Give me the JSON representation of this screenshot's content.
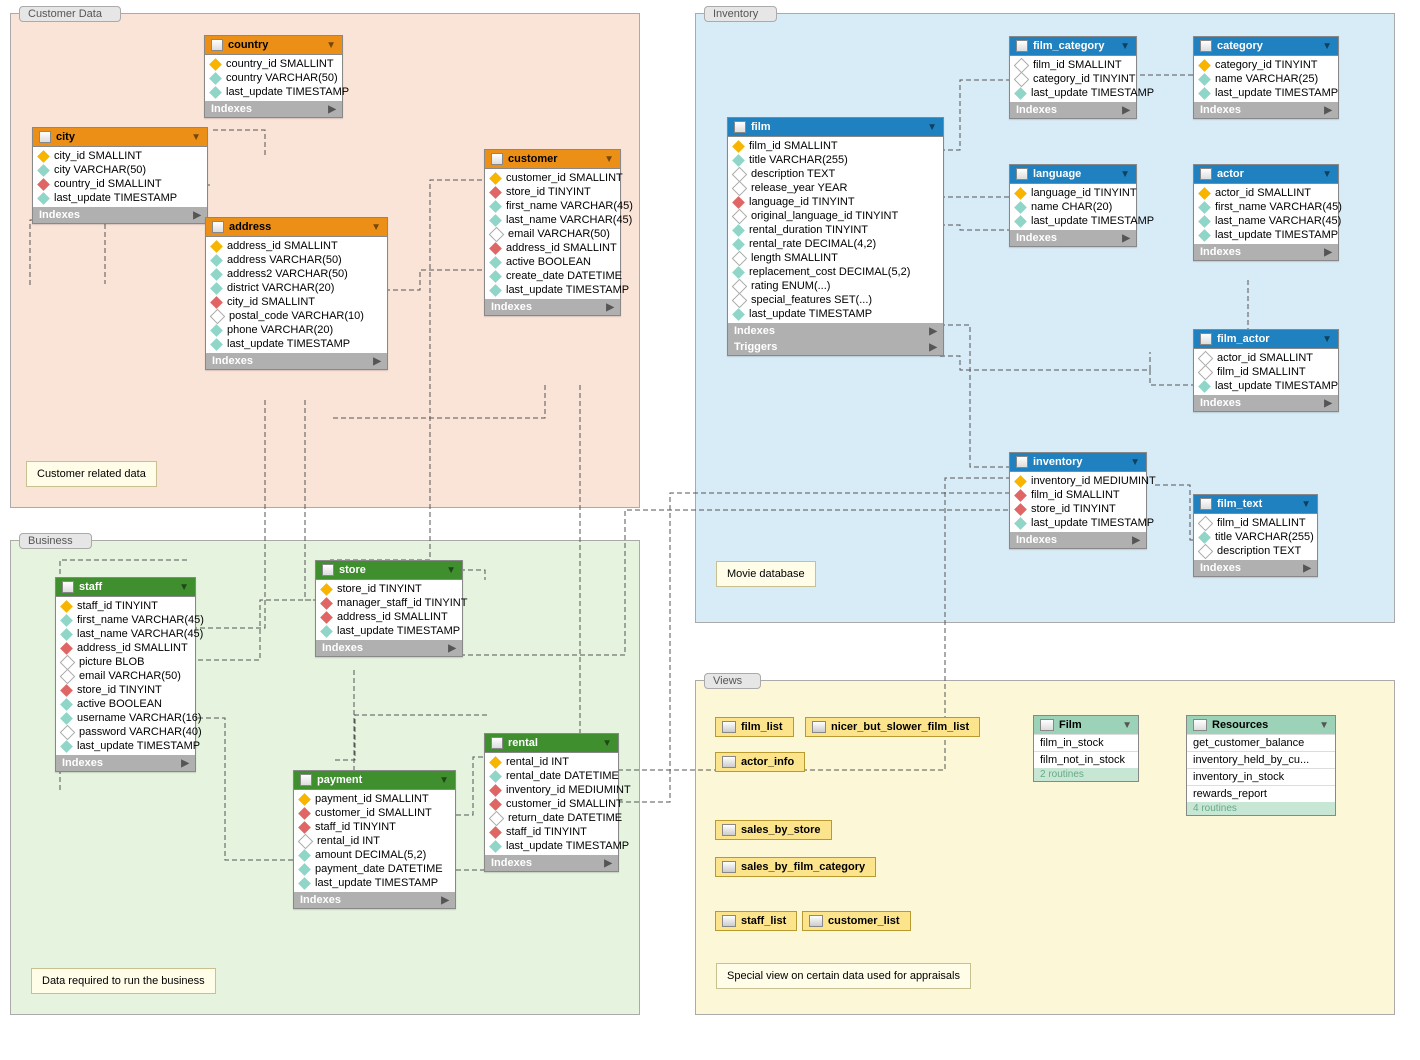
{
  "layers": {
    "customer": {
      "title": "Customer Data",
      "note": "Customer related data"
    },
    "business": {
      "title": "Business",
      "note": "Data required to run the business"
    },
    "inventory": {
      "title": "Inventory",
      "note": "Movie database"
    },
    "views": {
      "title": "Views",
      "note": "Special view on certain data used for appraisals"
    }
  },
  "entities": {
    "country": {
      "title": "country",
      "cols": [
        {
          "t": "pk",
          "name": "country_id SMALLINT"
        },
        {
          "t": "a",
          "name": "country VARCHAR(50)"
        },
        {
          "t": "a",
          "name": "last_update TIMESTAMP"
        }
      ],
      "sections": [
        "Indexes"
      ]
    },
    "city": {
      "title": "city",
      "cols": [
        {
          "t": "pk",
          "name": "city_id SMALLINT"
        },
        {
          "t": "a",
          "name": "city VARCHAR(50)"
        },
        {
          "t": "fk",
          "name": "country_id SMALLINT"
        },
        {
          "t": "a",
          "name": "last_update TIMESTAMP"
        }
      ],
      "sections": [
        "Indexes"
      ]
    },
    "address": {
      "title": "address",
      "cols": [
        {
          "t": "pk",
          "name": "address_id SMALLINT"
        },
        {
          "t": "a",
          "name": "address VARCHAR(50)"
        },
        {
          "t": "a",
          "name": "address2 VARCHAR(50)"
        },
        {
          "t": "a",
          "name": "district VARCHAR(20)"
        },
        {
          "t": "fk",
          "name": "city_id SMALLINT"
        },
        {
          "t": "n",
          "name": "postal_code VARCHAR(10)"
        },
        {
          "t": "a",
          "name": "phone VARCHAR(20)"
        },
        {
          "t": "a",
          "name": "last_update TIMESTAMP"
        }
      ],
      "sections": [
        "Indexes"
      ]
    },
    "customer": {
      "title": "customer",
      "cols": [
        {
          "t": "pk",
          "name": "customer_id SMALLINT"
        },
        {
          "t": "fk",
          "name": "store_id TINYINT"
        },
        {
          "t": "a",
          "name": "first_name VARCHAR(45)"
        },
        {
          "t": "a",
          "name": "last_name VARCHAR(45)"
        },
        {
          "t": "n",
          "name": "email VARCHAR(50)"
        },
        {
          "t": "fk",
          "name": "address_id SMALLINT"
        },
        {
          "t": "a",
          "name": "active BOOLEAN"
        },
        {
          "t": "a",
          "name": "create_date DATETIME"
        },
        {
          "t": "a",
          "name": "last_update TIMESTAMP"
        }
      ],
      "sections": [
        "Indexes"
      ]
    },
    "staff": {
      "title": "staff",
      "cols": [
        {
          "t": "pk",
          "name": "staff_id TINYINT"
        },
        {
          "t": "a",
          "name": "first_name VARCHAR(45)"
        },
        {
          "t": "a",
          "name": "last_name VARCHAR(45)"
        },
        {
          "t": "fk",
          "name": "address_id SMALLINT"
        },
        {
          "t": "n",
          "name": "picture BLOB"
        },
        {
          "t": "n",
          "name": "email VARCHAR(50)"
        },
        {
          "t": "fk",
          "name": "store_id TINYINT"
        },
        {
          "t": "a",
          "name": "active BOOLEAN"
        },
        {
          "t": "a",
          "name": "username VARCHAR(16)"
        },
        {
          "t": "n",
          "name": "password VARCHAR(40)"
        },
        {
          "t": "a",
          "name": "last_update TIMESTAMP"
        }
      ],
      "sections": [
        "Indexes"
      ]
    },
    "store": {
      "title": "store",
      "cols": [
        {
          "t": "pk",
          "name": "store_id TINYINT"
        },
        {
          "t": "fk",
          "name": "manager_staff_id TINYINT"
        },
        {
          "t": "fk",
          "name": "address_id SMALLINT"
        },
        {
          "t": "a",
          "name": "last_update TIMESTAMP"
        }
      ],
      "sections": [
        "Indexes"
      ]
    },
    "payment": {
      "title": "payment",
      "cols": [
        {
          "t": "pk",
          "name": "payment_id SMALLINT"
        },
        {
          "t": "fk",
          "name": "customer_id SMALLINT"
        },
        {
          "t": "fk",
          "name": "staff_id TINYINT"
        },
        {
          "t": "n",
          "name": "rental_id INT"
        },
        {
          "t": "a",
          "name": "amount DECIMAL(5,2)"
        },
        {
          "t": "a",
          "name": "payment_date DATETIME"
        },
        {
          "t": "a",
          "name": "last_update TIMESTAMP"
        }
      ],
      "sections": [
        "Indexes"
      ]
    },
    "rental": {
      "title": "rental",
      "cols": [
        {
          "t": "pk",
          "name": "rental_id INT"
        },
        {
          "t": "a",
          "name": "rental_date DATETIME"
        },
        {
          "t": "fk",
          "name": "inventory_id MEDIUMINT"
        },
        {
          "t": "fk",
          "name": "customer_id SMALLINT"
        },
        {
          "t": "n",
          "name": "return_date DATETIME"
        },
        {
          "t": "fk",
          "name": "staff_id TINYINT"
        },
        {
          "t": "a",
          "name": "last_update TIMESTAMP"
        }
      ],
      "sections": [
        "Indexes"
      ]
    },
    "film": {
      "title": "film",
      "cols": [
        {
          "t": "pk",
          "name": "film_id SMALLINT"
        },
        {
          "t": "a",
          "name": "title VARCHAR(255)"
        },
        {
          "t": "n",
          "name": "description TEXT"
        },
        {
          "t": "n",
          "name": "release_year YEAR"
        },
        {
          "t": "fk",
          "name": "language_id TINYINT"
        },
        {
          "t": "n",
          "name": "original_language_id TINYINT"
        },
        {
          "t": "a",
          "name": "rental_duration TINYINT"
        },
        {
          "t": "a",
          "name": "rental_rate DECIMAL(4,2)"
        },
        {
          "t": "n",
          "name": "length SMALLINT"
        },
        {
          "t": "a",
          "name": "replacement_cost DECIMAL(5,2)"
        },
        {
          "t": "n",
          "name": "rating ENUM(...)"
        },
        {
          "t": "n",
          "name": "special_features SET(...)"
        },
        {
          "t": "a",
          "name": "last_update TIMESTAMP"
        }
      ],
      "sections": [
        "Indexes",
        "Triggers"
      ]
    },
    "film_category": {
      "title": "film_category",
      "cols": [
        {
          "t": "n",
          "name": "film_id SMALLINT"
        },
        {
          "t": "n",
          "name": "category_id TINYINT"
        },
        {
          "t": "a",
          "name": "last_update TIMESTAMP"
        }
      ],
      "sections": [
        "Indexes"
      ]
    },
    "category": {
      "title": "category",
      "cols": [
        {
          "t": "pk",
          "name": "category_id TINYINT"
        },
        {
          "t": "a",
          "name": "name VARCHAR(25)"
        },
        {
          "t": "a",
          "name": "last_update TIMESTAMP"
        }
      ],
      "sections": [
        "Indexes"
      ]
    },
    "language": {
      "title": "language",
      "cols": [
        {
          "t": "pk",
          "name": "language_id TINYINT"
        },
        {
          "t": "a",
          "name": "name CHAR(20)"
        },
        {
          "t": "a",
          "name": "last_update TIMESTAMP"
        }
      ],
      "sections": [
        "Indexes"
      ]
    },
    "actor": {
      "title": "actor",
      "cols": [
        {
          "t": "pk",
          "name": "actor_id SMALLINT"
        },
        {
          "t": "a",
          "name": "first_name VARCHAR(45)"
        },
        {
          "t": "a",
          "name": "last_name VARCHAR(45)"
        },
        {
          "t": "a",
          "name": "last_update TIMESTAMP"
        }
      ],
      "sections": [
        "Indexes"
      ]
    },
    "film_actor": {
      "title": "film_actor",
      "cols": [
        {
          "t": "n",
          "name": "actor_id SMALLINT"
        },
        {
          "t": "n",
          "name": "film_id SMALLINT"
        },
        {
          "t": "a",
          "name": "last_update TIMESTAMP"
        }
      ],
      "sections": [
        "Indexes"
      ]
    },
    "inventory_ent": {
      "title": "inventory",
      "cols": [
        {
          "t": "pk",
          "name": "inventory_id MEDIUMINT"
        },
        {
          "t": "fk",
          "name": "film_id SMALLINT"
        },
        {
          "t": "fk",
          "name": "store_id TINYINT"
        },
        {
          "t": "a",
          "name": "last_update TIMESTAMP"
        }
      ],
      "sections": [
        "Indexes"
      ]
    },
    "film_text": {
      "title": "film_text",
      "cols": [
        {
          "t": "n",
          "name": "film_id SMALLINT"
        },
        {
          "t": "a",
          "name": "title VARCHAR(255)"
        },
        {
          "t": "n",
          "name": "description TEXT"
        }
      ],
      "sections": [
        "Indexes"
      ]
    }
  },
  "views_chips": {
    "film_list": "film_list",
    "nicer": "nicer_but_slower_film_list",
    "actor_info": "actor_info",
    "sales_by_store": "sales_by_store",
    "sales_by_film_category": "sales_by_film_category",
    "staff_list": "staff_list",
    "customer_list": "customer_list"
  },
  "routines": {
    "film": {
      "title": "Film",
      "items": [
        "film_in_stock",
        "film_not_in_stock"
      ],
      "foot": "2 routines"
    },
    "resources": {
      "title": "Resources",
      "items": [
        "get_customer_balance",
        "inventory_held_by_cu...",
        "inventory_in_stock",
        "rewards_report"
      ],
      "foot": "4 routines"
    }
  }
}
